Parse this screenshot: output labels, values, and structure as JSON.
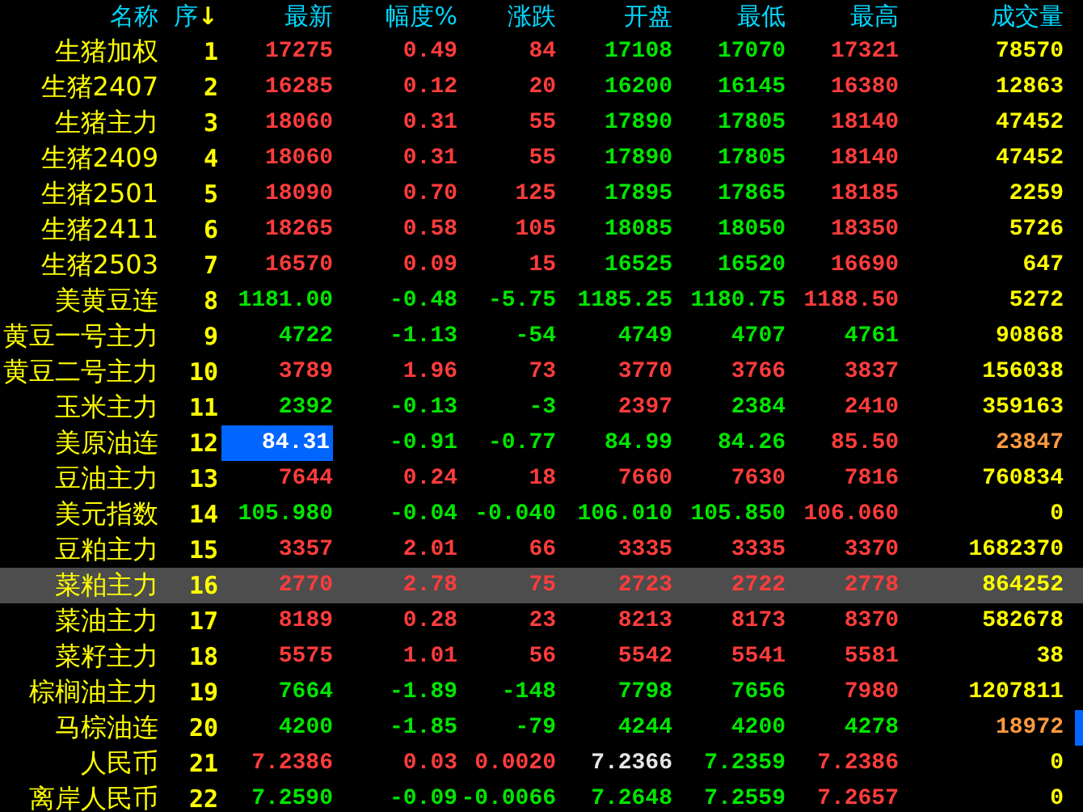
{
  "columns": [
    {
      "label": "名称"
    },
    {
      "label": "序",
      "sort_arrow": "↓"
    },
    {
      "label": "最新"
    },
    {
      "label": "幅度%"
    },
    {
      "label": "涨跌"
    },
    {
      "label": "开盘"
    },
    {
      "label": "最低"
    },
    {
      "label": "最高"
    },
    {
      "label": "成交量"
    }
  ],
  "rows": [
    {
      "name": "生猪加权",
      "index": "1",
      "selected": false,
      "cursor": false,
      "marker": false,
      "cells": [
        {
          "text": "17275",
          "color": "#ff3c3c"
        },
        {
          "text": "0.49",
          "color": "#ff3c3c"
        },
        {
          "text": "84",
          "color": "#ff3c3c"
        },
        {
          "text": "17108",
          "color": "#00e600"
        },
        {
          "text": "17070",
          "color": "#00e600"
        },
        {
          "text": "17321",
          "color": "#ff3c3c"
        },
        {
          "text": "78570",
          "color": "#ffff00"
        }
      ]
    },
    {
      "name": "生猪2407",
      "index": "2",
      "selected": false,
      "cursor": false,
      "marker": false,
      "cells": [
        {
          "text": "16285",
          "color": "#ff3c3c"
        },
        {
          "text": "0.12",
          "color": "#ff3c3c"
        },
        {
          "text": "20",
          "color": "#ff3c3c"
        },
        {
          "text": "16200",
          "color": "#00e600"
        },
        {
          "text": "16145",
          "color": "#00e600"
        },
        {
          "text": "16380",
          "color": "#ff3c3c"
        },
        {
          "text": "12863",
          "color": "#ffff00"
        }
      ]
    },
    {
      "name": "生猪主力",
      "index": "3",
      "selected": false,
      "cursor": false,
      "marker": false,
      "cells": [
        {
          "text": "18060",
          "color": "#ff3c3c"
        },
        {
          "text": "0.31",
          "color": "#ff3c3c"
        },
        {
          "text": "55",
          "color": "#ff3c3c"
        },
        {
          "text": "17890",
          "color": "#00e600"
        },
        {
          "text": "17805",
          "color": "#00e600"
        },
        {
          "text": "18140",
          "color": "#ff3c3c"
        },
        {
          "text": "47452",
          "color": "#ffff00"
        }
      ]
    },
    {
      "name": "生猪2409",
      "index": "4",
      "selected": false,
      "cursor": false,
      "marker": false,
      "cells": [
        {
          "text": "18060",
          "color": "#ff3c3c"
        },
        {
          "text": "0.31",
          "color": "#ff3c3c"
        },
        {
          "text": "55",
          "color": "#ff3c3c"
        },
        {
          "text": "17890",
          "color": "#00e600"
        },
        {
          "text": "17805",
          "color": "#00e600"
        },
        {
          "text": "18140",
          "color": "#ff3c3c"
        },
        {
          "text": "47452",
          "color": "#ffff00"
        }
      ]
    },
    {
      "name": "生猪2501",
      "index": "5",
      "selected": false,
      "cursor": false,
      "marker": false,
      "cells": [
        {
          "text": "18090",
          "color": "#ff3c3c"
        },
        {
          "text": "0.70",
          "color": "#ff3c3c"
        },
        {
          "text": "125",
          "color": "#ff3c3c"
        },
        {
          "text": "17895",
          "color": "#00e600"
        },
        {
          "text": "17865",
          "color": "#00e600"
        },
        {
          "text": "18185",
          "color": "#ff3c3c"
        },
        {
          "text": "2259",
          "color": "#ffff00"
        }
      ]
    },
    {
      "name": "生猪2411",
      "index": "6",
      "selected": false,
      "cursor": false,
      "marker": false,
      "cells": [
        {
          "text": "18265",
          "color": "#ff3c3c"
        },
        {
          "text": "0.58",
          "color": "#ff3c3c"
        },
        {
          "text": "105",
          "color": "#ff3c3c"
        },
        {
          "text": "18085",
          "color": "#00e600"
        },
        {
          "text": "18050",
          "color": "#00e600"
        },
        {
          "text": "18350",
          "color": "#ff3c3c"
        },
        {
          "text": "5726",
          "color": "#ffff00"
        }
      ]
    },
    {
      "name": "生猪2503",
      "index": "7",
      "selected": false,
      "cursor": false,
      "marker": false,
      "cells": [
        {
          "text": "16570",
          "color": "#ff3c3c"
        },
        {
          "text": "0.09",
          "color": "#ff3c3c"
        },
        {
          "text": "15",
          "color": "#ff3c3c"
        },
        {
          "text": "16525",
          "color": "#00e600"
        },
        {
          "text": "16520",
          "color": "#00e600"
        },
        {
          "text": "16690",
          "color": "#ff3c3c"
        },
        {
          "text": "647",
          "color": "#ffff00"
        }
      ]
    },
    {
      "name": "美黄豆连",
      "index": "8",
      "selected": false,
      "cursor": false,
      "marker": false,
      "cells": [
        {
          "text": "1181.00",
          "color": "#00e600"
        },
        {
          "text": "-0.48",
          "color": "#00e600"
        },
        {
          "text": "-5.75",
          "color": "#00e600"
        },
        {
          "text": "1185.25",
          "color": "#00e600"
        },
        {
          "text": "1180.75",
          "color": "#00e600"
        },
        {
          "text": "1188.50",
          "color": "#ff3c3c"
        },
        {
          "text": "5272",
          "color": "#ffff00"
        }
      ]
    },
    {
      "name": "黄豆一号主力",
      "index": "9",
      "selected": false,
      "cursor": false,
      "marker": false,
      "cells": [
        {
          "text": "4722",
          "color": "#00e600"
        },
        {
          "text": "-1.13",
          "color": "#00e600"
        },
        {
          "text": "-54",
          "color": "#00e600"
        },
        {
          "text": "4749",
          "color": "#00e600"
        },
        {
          "text": "4707",
          "color": "#00e600"
        },
        {
          "text": "4761",
          "color": "#00e600"
        },
        {
          "text": "90868",
          "color": "#ffff00"
        }
      ]
    },
    {
      "name": "黄豆二号主力",
      "index": "10",
      "selected": false,
      "cursor": false,
      "marker": false,
      "cells": [
        {
          "text": "3789",
          "color": "#ff3c3c"
        },
        {
          "text": "1.96",
          "color": "#ff3c3c"
        },
        {
          "text": "73",
          "color": "#ff3c3c"
        },
        {
          "text": "3770",
          "color": "#ff3c3c"
        },
        {
          "text": "3766",
          "color": "#ff3c3c"
        },
        {
          "text": "3837",
          "color": "#ff3c3c"
        },
        {
          "text": "156038",
          "color": "#ffff00"
        }
      ]
    },
    {
      "name": "玉米主力",
      "index": "11",
      "selected": false,
      "cursor": false,
      "marker": false,
      "cells": [
        {
          "text": "2392",
          "color": "#00e600"
        },
        {
          "text": "-0.13",
          "color": "#00e600"
        },
        {
          "text": "-3",
          "color": "#00e600"
        },
        {
          "text": "2397",
          "color": "#ff3c3c"
        },
        {
          "text": "2384",
          "color": "#00e600"
        },
        {
          "text": "2410",
          "color": "#ff3c3c"
        },
        {
          "text": "359163",
          "color": "#ffff00"
        }
      ]
    },
    {
      "name": "美原油连",
      "index": "12",
      "selected": false,
      "cursor": true,
      "marker": false,
      "cells": [
        {
          "text": "84.31",
          "color": "#ffffff"
        },
        {
          "text": "-0.91",
          "color": "#00e600"
        },
        {
          "text": "-0.77",
          "color": "#00e600"
        },
        {
          "text": "84.99",
          "color": "#00e600"
        },
        {
          "text": "84.26",
          "color": "#00e600"
        },
        {
          "text": "85.50",
          "color": "#ff3c3c"
        },
        {
          "text": "23847",
          "color": "#ff9a40"
        }
      ]
    },
    {
      "name": "豆油主力",
      "index": "13",
      "selected": false,
      "cursor": false,
      "marker": false,
      "cells": [
        {
          "text": "7644",
          "color": "#ff3c3c"
        },
        {
          "text": "0.24",
          "color": "#ff3c3c"
        },
        {
          "text": "18",
          "color": "#ff3c3c"
        },
        {
          "text": "7660",
          "color": "#ff3c3c"
        },
        {
          "text": "7630",
          "color": "#ff3c3c"
        },
        {
          "text": "7816",
          "color": "#ff3c3c"
        },
        {
          "text": "760834",
          "color": "#ffff00"
        }
      ]
    },
    {
      "name": "美元指数",
      "index": "14",
      "selected": false,
      "cursor": false,
      "marker": false,
      "cells": [
        {
          "text": "105.980",
          "color": "#00e600"
        },
        {
          "text": "-0.04",
          "color": "#00e600"
        },
        {
          "text": "-0.040",
          "color": "#00e600"
        },
        {
          "text": "106.010",
          "color": "#00e600"
        },
        {
          "text": "105.850",
          "color": "#00e600"
        },
        {
          "text": "106.060",
          "color": "#ff3c3c"
        },
        {
          "text": "0",
          "color": "#ffff00"
        }
      ]
    },
    {
      "name": "豆粕主力",
      "index": "15",
      "selected": false,
      "cursor": false,
      "marker": false,
      "cells": [
        {
          "text": "3357",
          "color": "#ff3c3c"
        },
        {
          "text": "2.01",
          "color": "#ff3c3c"
        },
        {
          "text": "66",
          "color": "#ff3c3c"
        },
        {
          "text": "3335",
          "color": "#ff3c3c"
        },
        {
          "text": "3335",
          "color": "#ff3c3c"
        },
        {
          "text": "3370",
          "color": "#ff3c3c"
        },
        {
          "text": "1682370",
          "color": "#ffff00"
        }
      ]
    },
    {
      "name": "菜粕主力",
      "index": "16",
      "selected": true,
      "cursor": false,
      "marker": false,
      "cells": [
        {
          "text": "2770",
          "color": "#ff3c3c"
        },
        {
          "text": "2.78",
          "color": "#ff3c3c"
        },
        {
          "text": "75",
          "color": "#ff3c3c"
        },
        {
          "text": "2723",
          "color": "#ff3c3c"
        },
        {
          "text": "2722",
          "color": "#ff3c3c"
        },
        {
          "text": "2778",
          "color": "#ff3c3c"
        },
        {
          "text": "864252",
          "color": "#ffff00"
        }
      ]
    },
    {
      "name": "菜油主力",
      "index": "17",
      "selected": false,
      "cursor": false,
      "marker": false,
      "cells": [
        {
          "text": "8189",
          "color": "#ff3c3c"
        },
        {
          "text": "0.28",
          "color": "#ff3c3c"
        },
        {
          "text": "23",
          "color": "#ff3c3c"
        },
        {
          "text": "8213",
          "color": "#ff3c3c"
        },
        {
          "text": "8173",
          "color": "#ff3c3c"
        },
        {
          "text": "8370",
          "color": "#ff3c3c"
        },
        {
          "text": "582678",
          "color": "#ffff00"
        }
      ]
    },
    {
      "name": "菜籽主力",
      "index": "18",
      "selected": false,
      "cursor": false,
      "marker": false,
      "cells": [
        {
          "text": "5575",
          "color": "#ff3c3c"
        },
        {
          "text": "1.01",
          "color": "#ff3c3c"
        },
        {
          "text": "56",
          "color": "#ff3c3c"
        },
        {
          "text": "5542",
          "color": "#ff3c3c"
        },
        {
          "text": "5541",
          "color": "#ff3c3c"
        },
        {
          "text": "5581",
          "color": "#ff3c3c"
        },
        {
          "text": "38",
          "color": "#ffff00"
        }
      ]
    },
    {
      "name": "棕榈油主力",
      "index": "19",
      "selected": false,
      "cursor": false,
      "marker": false,
      "cells": [
        {
          "text": "7664",
          "color": "#00e600"
        },
        {
          "text": "-1.89",
          "color": "#00e600"
        },
        {
          "text": "-148",
          "color": "#00e600"
        },
        {
          "text": "7798",
          "color": "#00e600"
        },
        {
          "text": "7656",
          "color": "#00e600"
        },
        {
          "text": "7980",
          "color": "#ff3c3c"
        },
        {
          "text": "1207811",
          "color": "#ffff00"
        }
      ]
    },
    {
      "name": "马棕油连",
      "index": "20",
      "selected": false,
      "cursor": false,
      "marker": true,
      "cells": [
        {
          "text": "4200",
          "color": "#00e600"
        },
        {
          "text": "-1.85",
          "color": "#00e600"
        },
        {
          "text": "-79",
          "color": "#00e600"
        },
        {
          "text": "4244",
          "color": "#00e600"
        },
        {
          "text": "4200",
          "color": "#00e600"
        },
        {
          "text": "4278",
          "color": "#00e600"
        },
        {
          "text": "18972",
          "color": "#ff9a40"
        }
      ]
    },
    {
      "name": "人民币",
      "index": "21",
      "selected": false,
      "cursor": false,
      "marker": false,
      "cells": [
        {
          "text": "7.2386",
          "color": "#ff3c3c"
        },
        {
          "text": "0.03",
          "color": "#ff3c3c"
        },
        {
          "text": "0.0020",
          "color": "#ff3c3c"
        },
        {
          "text": "7.2366",
          "color": "#e6e6e6"
        },
        {
          "text": "7.2359",
          "color": "#00e600"
        },
        {
          "text": "7.2386",
          "color": "#ff3c3c"
        },
        {
          "text": "0",
          "color": "#ffff00"
        }
      ]
    },
    {
      "name": "离岸人民币",
      "index": "22",
      "selected": false,
      "cursor": false,
      "marker": false,
      "cells": [
        {
          "text": "7.2590",
          "color": "#00e600"
        },
        {
          "text": "-0.09",
          "color": "#00e600"
        },
        {
          "text": "-0.0066",
          "color": "#00e600"
        },
        {
          "text": "7.2648",
          "color": "#00e600"
        },
        {
          "text": "7.2559",
          "color": "#00e600"
        },
        {
          "text": "7.2657",
          "color": "#ff3c3c"
        },
        {
          "text": "0",
          "color": "#ffff00"
        }
      ]
    }
  ]
}
